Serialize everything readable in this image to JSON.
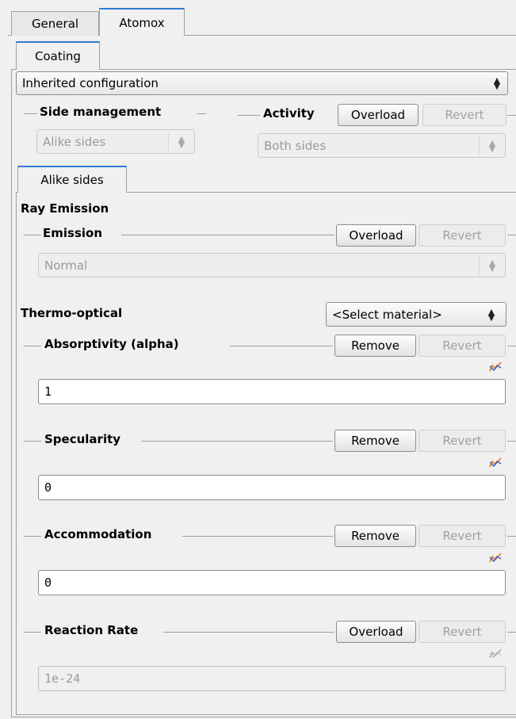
{
  "tabs": {
    "general": "General",
    "atomox": "Atomox"
  },
  "subtab": "Coating",
  "config": {
    "value": "Inherited configuration"
  },
  "side_management": {
    "label": "Side management",
    "value": "Alike sides"
  },
  "activity": {
    "label": "Activity",
    "overload": "Overload",
    "revert": "Revert",
    "value": "Both sides"
  },
  "inner_tab": "Alike sides",
  "ray_emission": {
    "title": "Ray Emission",
    "emission_label": "Emission",
    "overload": "Overload",
    "revert": "Revert",
    "value": "Normal"
  },
  "thermo": {
    "title": "Thermo-optical",
    "material": "<Select material>"
  },
  "absorptivity": {
    "label": "Absorptivity (alpha)",
    "remove": "Remove",
    "revert": "Revert",
    "value": "1"
  },
  "specularity": {
    "label": "Specularity",
    "remove": "Remove",
    "revert": "Revert",
    "value": "0"
  },
  "accommodation": {
    "label": "Accommodation",
    "remove": "Remove",
    "revert": "Revert",
    "value": "0"
  },
  "reaction_rate": {
    "label": "Reaction Rate",
    "overload": "Overload",
    "revert": "Revert",
    "value": "1e-24"
  },
  "colors": {
    "accent": "#2e7bd6",
    "graph_orange": "#e07a1f",
    "graph_blue": "#3a5fc8"
  }
}
